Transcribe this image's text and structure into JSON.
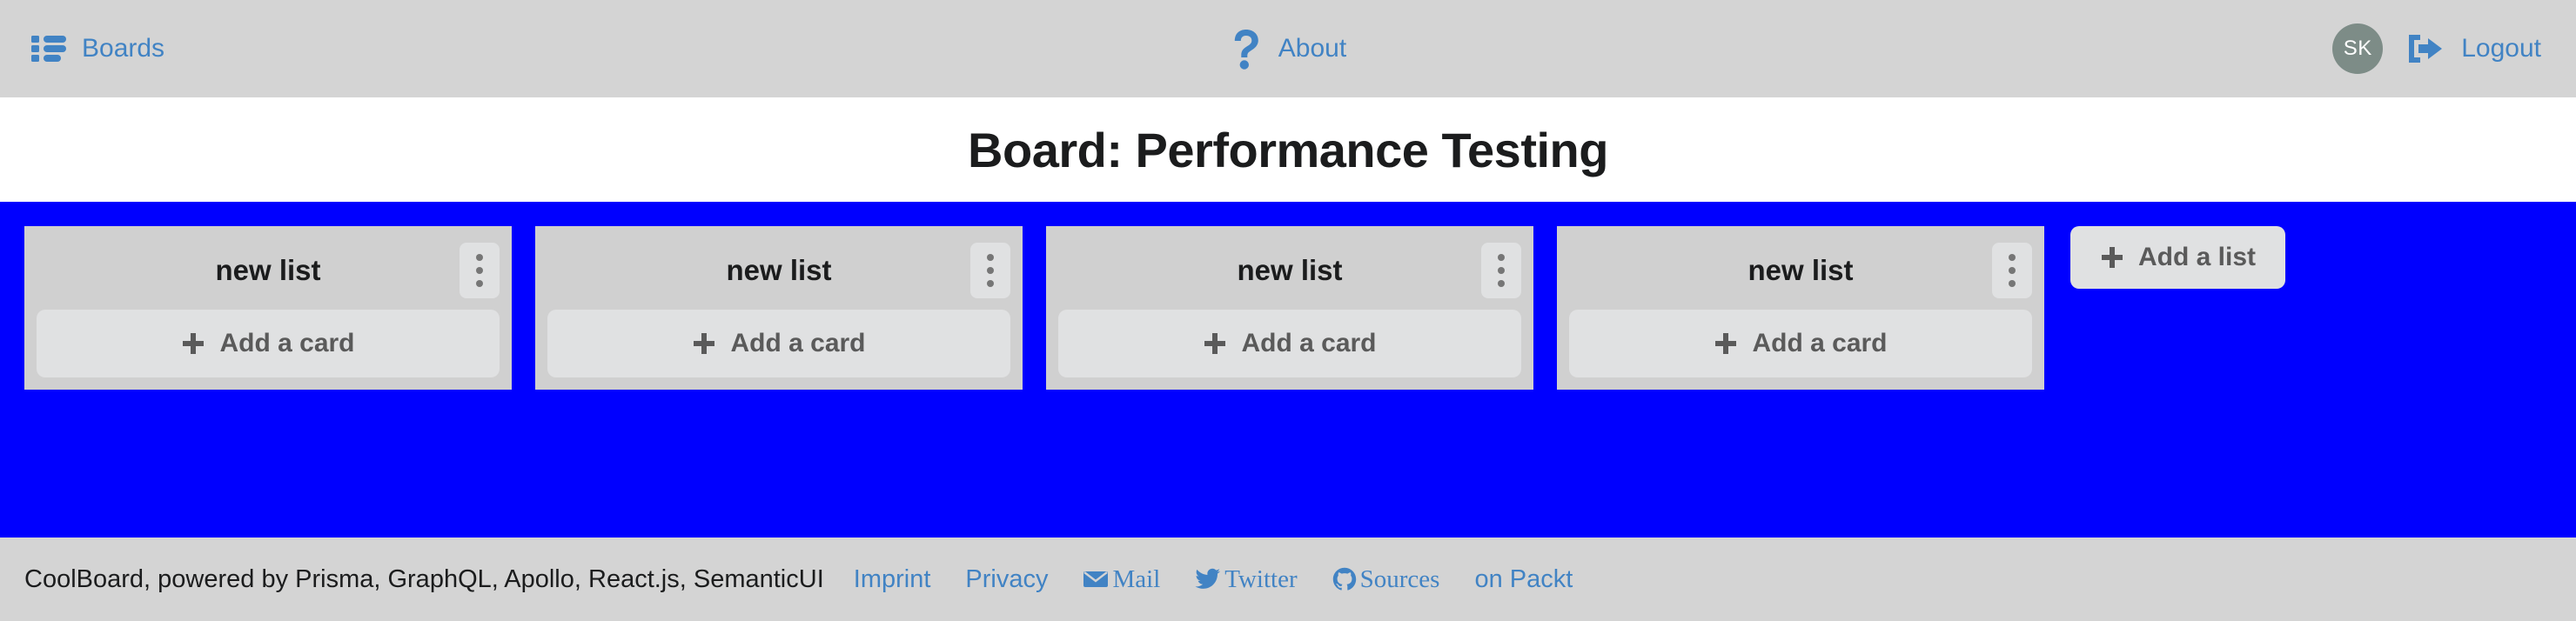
{
  "nav": {
    "boards_label": "Boards",
    "boards_icon": "list-icon",
    "about_label": "About",
    "about_icon": "question-mark-icon",
    "avatar_initials": "SK",
    "logout_label": "Logout",
    "logout_icon": "sign-out-icon",
    "link_color": "#4183c4",
    "background": "#d4d4d4"
  },
  "board": {
    "title": "Board: Performance Testing",
    "background_color": "#0000ff",
    "lists": [
      {
        "title": "new list",
        "add_card_label": "Add a card",
        "menu_icon": "vertical-ellipsis-icon"
      },
      {
        "title": "new list",
        "add_card_label": "Add a card",
        "menu_icon": "vertical-ellipsis-icon"
      },
      {
        "title": "new list",
        "add_card_label": "Add a card",
        "menu_icon": "vertical-ellipsis-icon"
      },
      {
        "title": "new list",
        "add_card_label": "Add a card",
        "menu_icon": "vertical-ellipsis-icon"
      }
    ],
    "add_list_label": "Add a list",
    "add_list_icon": "plus-icon"
  },
  "footer": {
    "credit": "CoolBoard, powered by Prisma, GraphQL, Apollo, React.js, SemanticUI",
    "links": [
      {
        "label": "Imprint",
        "icon": null
      },
      {
        "label": "Privacy",
        "icon": null
      },
      {
        "label": "Mail",
        "icon": "envelope-icon"
      },
      {
        "label": "Twitter",
        "icon": "twitter-bird-icon"
      },
      {
        "label": "Sources",
        "icon": "github-icon"
      },
      {
        "label": "on Packt",
        "icon": null
      }
    ],
    "background": "#d4d4d4"
  }
}
